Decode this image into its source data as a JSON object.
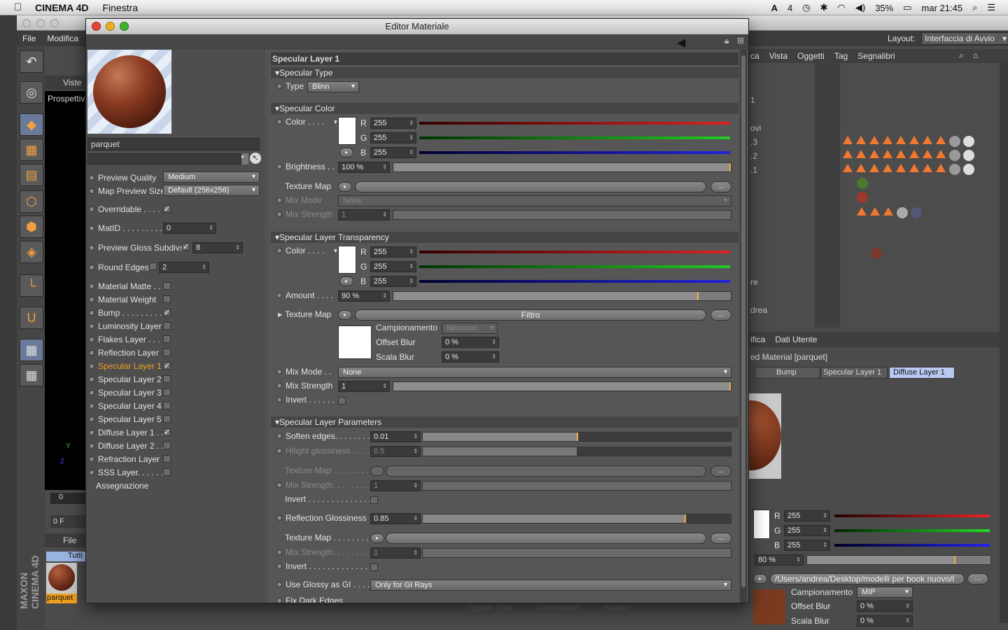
{
  "menubar": {
    "app": "CINEMA 4D",
    "menu": "Finestra",
    "status": [
      "4",
      "35%",
      "mar 21:45"
    ]
  },
  "main": {
    "menu": [
      "File",
      "Modifica"
    ],
    "layout_label": "Layout:",
    "layout_value": "Interfaccia di Avvio",
    "viewport_tabs": [
      "Viste",
      "Prospettiva"
    ],
    "timeline": {
      "frame": "0",
      "frame_field": "0 F"
    },
    "brand": "MAXON CINEMA 4D",
    "file_tab": "File",
    "filter_tab": "Tutti",
    "material_thumb_label": "parquet",
    "objects_menu": [
      "ca",
      "Vista",
      "Oggetti",
      "Tag",
      "Segnalibri"
    ],
    "object_row_labels": [
      "1",
      "ovi",
      ".3",
      ".2",
      ".1",
      "re",
      "drea"
    ],
    "attrib_menu": [
      "ifica",
      "Dati Utente"
    ],
    "attrib_title": "ed Material [parquet]",
    "attrib_tabs": [
      "Bump",
      "Specular Layer 1",
      "Diffuse Layer 1"
    ],
    "attrib_color": {
      "r": "255",
      "g": "255",
      "b": "255",
      "r_label": "R",
      "g_label": "G",
      "b_label": "B"
    },
    "attrib_brightness": "80 %",
    "attrib_path": "/Users/andrea/Desktop/modelli per book nuovo/l",
    "attrib_sampling_label": "Campionamento",
    "attrib_sampling": "MIP",
    "attrib_offset_label": "Offset Blur",
    "attrib_offset": "0 %",
    "attrib_scala_label": "Scala Blur",
    "attrib_scala": "0 %",
    "bottom_buttons": [
      "Oggetto (Rel)",
      "Dimensione",
      "Applica"
    ]
  },
  "editor": {
    "title": "Editor Materiale",
    "material_name": "parquet",
    "left_props": [
      {
        "label": "Preview Quality",
        "value": "Medium"
      },
      {
        "label": "Map Preview Size",
        "value": "Default (256x256)"
      },
      {
        "label": "Overridable . . . . .",
        "checked": "✓"
      },
      {
        "label": "MatID . . . . . . . . . .",
        "value": "0"
      },
      {
        "label": "Preview Gloss Subdivs",
        "checked": "✓",
        "value": "8"
      },
      {
        "label": "Round Edges",
        "value": "2"
      }
    ],
    "channels": [
      {
        "label": "Material Matte . .",
        "checked": ""
      },
      {
        "label": "Material Weight",
        "checked": ""
      },
      {
        "label": "Bump . . . . . . . . .",
        "checked": "✓"
      },
      {
        "label": "Luminosity Layer",
        "checked": ""
      },
      {
        "label": "Flakes Layer . . . .",
        "checked": ""
      },
      {
        "label": "Reflection Layer",
        "checked": ""
      },
      {
        "label": "Specular Layer 1",
        "checked": "✓",
        "active": true
      },
      {
        "label": "Specular Layer 2",
        "checked": ""
      },
      {
        "label": "Specular Layer 3",
        "checked": ""
      },
      {
        "label": "Specular Layer 4",
        "checked": ""
      },
      {
        "label": "Specular Layer 5",
        "checked": ""
      },
      {
        "label": "Diffuse Layer 1 . .",
        "checked": "✓"
      },
      {
        "label": "Diffuse Layer 2 . .",
        "checked": ""
      },
      {
        "label": "Refraction Layer",
        "checked": ""
      },
      {
        "label": "SSS Layer. . . . . . .",
        "checked": ""
      }
    ],
    "assign_label": "Assegnazione",
    "panel_title": "Specular Layer 1",
    "sec_type": "Specular Type",
    "type_label": "Type",
    "type_value": "Blinn",
    "sec_color": "Specular Color",
    "color_label": "Color . . . .",
    "rgb": {
      "r_label": "R",
      "g_label": "G",
      "b_label": "B",
      "r": "255",
      "g": "255",
      "b": "255"
    },
    "brightness_label": "Brightness . .",
    "brightness": "100 %",
    "texmap_label": "Texture Map",
    "dots": "...",
    "mixmode_label": "Mix Mode . .",
    "mixmode_dim": "None",
    "mixstrength_label": "Mix Strength",
    "mixstrength_dim": "1",
    "sec_transp": "Specular Layer Transparency",
    "t_rgb": {
      "r": "255",
      "g": "255",
      "b": "255"
    },
    "amount_label": "Amount . . . .",
    "amount": "90 %",
    "t_texmap_label": "Texture Map",
    "t_texmap_value": "Filtro",
    "sampling_label": "Campionamento",
    "sampling_value": "Nessuno",
    "offset_label": "Offset Blur",
    "offset_value": "0 %",
    "scala_label": "Scala Blur",
    "scala_value": "0 %",
    "t_mixmode_label": "Mix Mode . .",
    "t_mixmode": "None",
    "t_mixstrength_label": "Mix Strength",
    "t_mixstrength": "1",
    "invert_label": "Invert . . . . . .",
    "sec_params": "Specular Layer Parameters",
    "soften_label": "Soften edges. . . . . . . .",
    "soften": "0.01",
    "hilight_label": "Hilight glossiness . . . .",
    "hilight": "0.5",
    "p_texmap_label": "Texture Map . . . . . . . .",
    "p_mixstrength_label": "Mix Strength. . . . . . . .",
    "p_mixstrength": "1",
    "p_invert_label": "Invert . . . . . . . . . . . . . .",
    "refl_label": "Reflection Glossiness",
    "refl": "0.85",
    "p2_texmap_label": "Texture Map . . . . . . . .",
    "p2_mixstrength_label": "Mix Strength. . . . . . . .",
    "p2_mixstrength": "1",
    "p2_invert_label": "Invert . . . . . . . . . . . . . .",
    "glossy_label": "Use Glossy as GI . . . .",
    "glossy_value": "Only for GI Rays",
    "fix_label": "Fix Dark Edges"
  },
  "colors": {
    "accent": "#f0a020",
    "active_tab": "#b8c8f0"
  }
}
